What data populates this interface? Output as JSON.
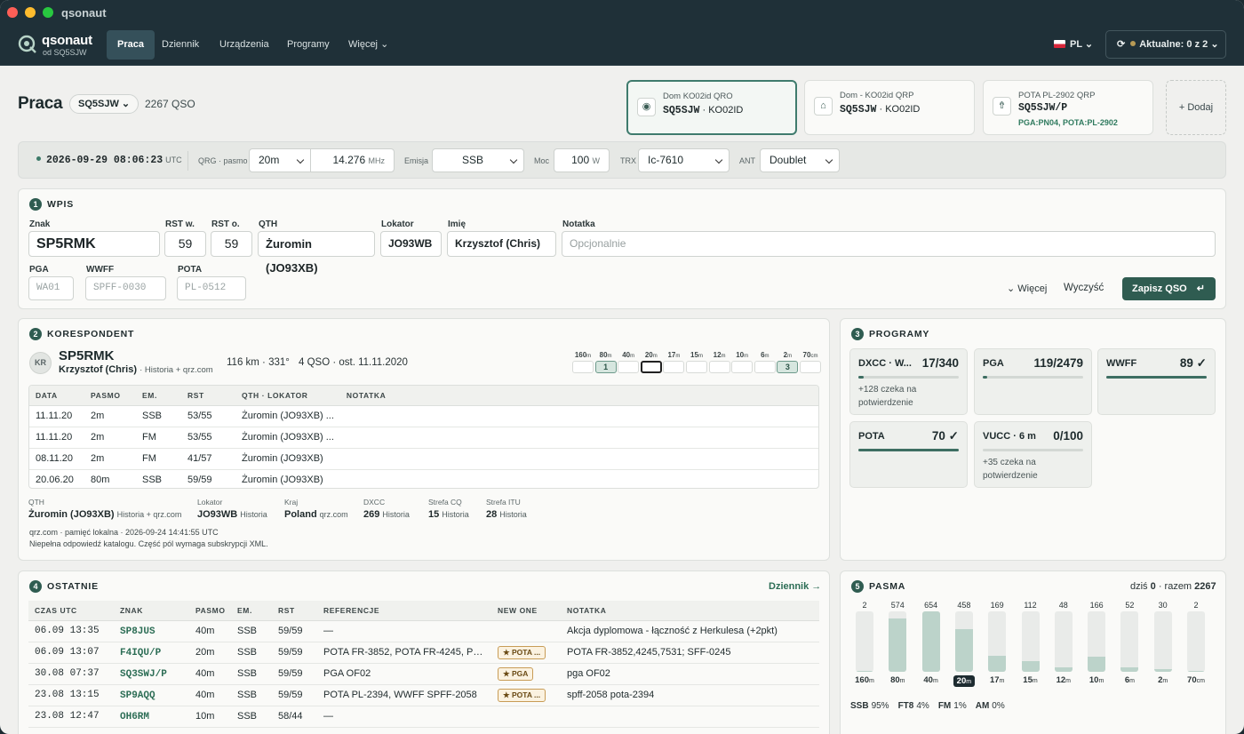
{
  "window": {
    "title": "qsonaut"
  },
  "nav": {
    "logo_name": "qsonaut",
    "logo_sub": "od SQ5SJW",
    "items": [
      "Praca",
      "Dziennik",
      "Urządzenia",
      "Programy",
      "Więcej"
    ],
    "lang": "PL",
    "sync": "Aktualne: 0 z 2"
  },
  "header": {
    "title": "Praca",
    "callsign": "SQ5SJW",
    "qso_count": "2267 QSO"
  },
  "stations": [
    {
      "l1": "Dom KO02id QRO",
      "call": "SQ5SJW",
      "loc": "· KO02ID",
      "l3": ""
    },
    {
      "l1": "Dom - KO02id QRP",
      "call": "SQ5SJW",
      "loc": "· KO02ID",
      "l3": ""
    },
    {
      "l1": "POTA PL-2902 QRP",
      "call": "SQ5SJW/P",
      "loc": "",
      "l3": "PGA:PN04, POTA:PL-2902"
    }
  ],
  "add_station": "+ Dodaj",
  "toolbar": {
    "datetime": "2026-09-29 08:06:23",
    "utc": "UTC",
    "qrg_label": "QRG · pasmo",
    "band": "20m",
    "freq": "14.276",
    "mhz": "MHz",
    "mode_label": "Emisja",
    "mode": "SSB",
    "power_label": "Moc",
    "power": "100",
    "w": "W",
    "trx_label": "TRX",
    "trx": "Ic-7610",
    "ant_label": "ANT",
    "ant": "Doublet"
  },
  "entry": {
    "num": "1",
    "title": "WPIS",
    "znak_l": "Znak",
    "znak": "SP5RMK",
    "rstw_l": "RST w.",
    "rstw": "59",
    "rsto_l": "RST o.",
    "rsto": "59",
    "qth_l": "QTH",
    "qth": "Żuromin (JO93XB)",
    "lok_l": "Lokator",
    "lok": "JO93WB",
    "imie_l": "Imię",
    "imie": "Krzysztof (Chris)",
    "note_l": "Notatka",
    "note_ph": "Opcjonalnie",
    "pga_l": "PGA",
    "pga_ph": "WA01",
    "wwff_l": "WWFF",
    "wwff_ph": "SPFF-0030",
    "pota_l": "POTA",
    "pota_ph": "PL-0512",
    "more": "Więcej",
    "clear": "Wyczyść",
    "save": "Zapisz QSO"
  },
  "corr": {
    "num": "2",
    "title": "KORESPONDENT",
    "avatar": "KR",
    "call": "SP5RMK",
    "name": "Krzysztof (Chris)",
    "name_src": "· Historia + qrz.com",
    "dist": "116 km · 331°",
    "qsos": "4 QSO · ost. 11.11.2020",
    "bands": [
      {
        "b": "160",
        "u": "m",
        "v": ""
      },
      {
        "b": "80",
        "u": "m",
        "v": "1"
      },
      {
        "b": "40",
        "u": "m",
        "v": ""
      },
      {
        "b": "20",
        "u": "m",
        "v": ""
      },
      {
        "b": "17",
        "u": "m",
        "v": ""
      },
      {
        "b": "15",
        "u": "m",
        "v": ""
      },
      {
        "b": "12",
        "u": "m",
        "v": ""
      },
      {
        "b": "10",
        "u": "m",
        "v": ""
      },
      {
        "b": "6",
        "u": "m",
        "v": ""
      },
      {
        "b": "2",
        "u": "m",
        "v": "3"
      },
      {
        "b": "70",
        "u": "cm",
        "v": ""
      }
    ],
    "cols": [
      "DATA",
      "PASMO",
      "EM.",
      "RST",
      "QTH · LOKATOR",
      "NOTATKA"
    ],
    "rows": [
      [
        "11.11.20",
        "2m",
        "SSB",
        "53/55",
        "Żuromin (JO93XB) ...",
        ""
      ],
      [
        "11.11.20",
        "2m",
        "FM",
        "53/55",
        "Żuromin (JO93XB) ...",
        ""
      ],
      [
        "08.11.20",
        "2m",
        "FM",
        "41/57",
        "Żuromin (JO93XB)",
        ""
      ],
      [
        "20.06.20",
        "80m",
        "SSB",
        "59/59",
        "Żuromin (JO93XB)",
        ""
      ]
    ],
    "meta": [
      {
        "l": "QTH",
        "v": "Żuromin (JO93XB)",
        "s": "Historia + qrz.com"
      },
      {
        "l": "Lokator",
        "v": "JO93WB",
        "s": "Historia"
      },
      {
        "l": "Kraj",
        "v": "Poland",
        "s": "qrz.com"
      },
      {
        "l": "DXCC",
        "v": "269",
        "s": "Historia"
      },
      {
        "l": "Strefa CQ",
        "v": "15",
        "s": "Historia"
      },
      {
        "l": "Strefa ITU",
        "v": "28",
        "s": "Historia"
      }
    ],
    "foot1": "qrz.com · pamięć lokalna · 2026-09-24 14:41:55 UTC",
    "foot2": "Niepełna odpowiedź katalogu. Część pól wymaga subskrypcji XML."
  },
  "programs": {
    "num": "3",
    "title": "PROGRAMY",
    "cards": [
      {
        "name": "DXCC · W...",
        "val": "17/340",
        "progress": 0.05,
        "sub": "+128 czeka na potwierdzenie"
      },
      {
        "name": "PGA",
        "val": "119/2479",
        "progress": 0.048,
        "sub": ""
      },
      {
        "name": "WWFF",
        "val": "89 ✓",
        "progress": 1,
        "sub": ""
      },
      {
        "name": "POTA",
        "val": "70 ✓",
        "progress": 1,
        "sub": ""
      },
      {
        "name": "VUCC · 6 m",
        "val": "0/100",
        "progress": 0,
        "sub": "+35 czeka na potwierdzenie"
      }
    ]
  },
  "recent": {
    "num": "4",
    "title": "OSTATNIE",
    "link": "Dziennik →",
    "cols": [
      "CZAS UTC",
      "ZNAK",
      "PASMO",
      "EM.",
      "RST",
      "REFERENCJE",
      "NEW ONE",
      "NOTATKA"
    ],
    "rows": [
      [
        "06.09 13:35",
        "SP8JUS",
        "40m",
        "SSB",
        "59/59",
        "—",
        "",
        "Akcja dyplomowa - łączność z Herkulesa (+2pkt)"
      ],
      [
        "06.09 13:07",
        "F4IQU/P",
        "20m",
        "SSB",
        "59/59",
        "POTA FR-3852, POTA FR-4245, PO...",
        "★ POTA ...",
        "POTA FR-3852,4245,7531; SFF-0245"
      ],
      [
        "30.08 07:37",
        "SQ3SWJ/P",
        "40m",
        "SSB",
        "59/59",
        "PGA OF02",
        "★ PGA",
        "pga OF02"
      ],
      [
        "23.08 13:15",
        "SP9AQQ",
        "40m",
        "SSB",
        "59/59",
        "POTA PL-2394, WWFF SPFF-2058",
        "★ POTA ...",
        "spff-2058 pota-2394"
      ],
      [
        "23.08 12:47",
        "OH6RM",
        "10m",
        "SSB",
        "58/44",
        "—",
        "",
        ""
      ]
    ]
  },
  "bands": {
    "num": "5",
    "title": "PASMA",
    "today_l": "dziś",
    "today": "0",
    "total_l": "· razem",
    "total": "2267",
    "items": [
      {
        "b": "160",
        "u": "m",
        "c": "2"
      },
      {
        "b": "80",
        "u": "m",
        "c": "574"
      },
      {
        "b": "40",
        "u": "m",
        "c": "654"
      },
      {
        "b": "20",
        "u": "m",
        "c": "458"
      },
      {
        "b": "17",
        "u": "m",
        "c": "169"
      },
      {
        "b": "15",
        "u": "m",
        "c": "112"
      },
      {
        "b": "12",
        "u": "m",
        "c": "48"
      },
      {
        "b": "10",
        "u": "m",
        "c": "166"
      },
      {
        "b": "6",
        "u": "m",
        "c": "52"
      },
      {
        "b": "2",
        "u": "m",
        "c": "30"
      },
      {
        "b": "70",
        "u": "cm",
        "c": "2"
      }
    ],
    "modes": [
      {
        "m": "SSB",
        "p": "95%"
      },
      {
        "m": "FT8",
        "p": "4%"
      },
      {
        "m": "FM",
        "p": "1%"
      },
      {
        "m": "AM",
        "p": "0%"
      }
    ]
  }
}
